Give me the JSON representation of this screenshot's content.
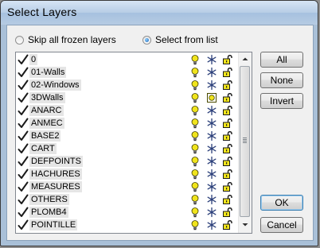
{
  "window": {
    "title": "Select Layers"
  },
  "options": {
    "skip_frozen": {
      "label": "Skip all frozen layers",
      "selected": false
    },
    "select_from_list": {
      "label": "Select from list",
      "selected": true
    }
  },
  "layers": [
    {
      "name": "0"
    },
    {
      "name": "01-Walls"
    },
    {
      "name": "02-Windows"
    },
    {
      "name": "3DWalls"
    },
    {
      "name": "ANARC"
    },
    {
      "name": "ANMEC"
    },
    {
      "name": "BASE2"
    },
    {
      "name": "CART"
    },
    {
      "name": "DEFPOINTS"
    },
    {
      "name": "HACHURES"
    },
    {
      "name": "MEASURES"
    },
    {
      "name": "OTHERS"
    },
    {
      "name": "PLOMB4"
    },
    {
      "name": "POINTILLE"
    }
  ],
  "buttons": {
    "all": "All",
    "none": "None",
    "invert": "Invert",
    "ok": "OK",
    "cancel": "Cancel"
  },
  "icons": {
    "check": "checkmark-icon",
    "on": "lightbulb-icon",
    "freeze": "snowflake-icon",
    "sun": "sun-icon",
    "lock": "unlocked-padlock-icon"
  },
  "colors": {
    "bulb": "#f0e41c",
    "title_bar": "#b7cde6",
    "default_border": "#3c7fb1"
  }
}
